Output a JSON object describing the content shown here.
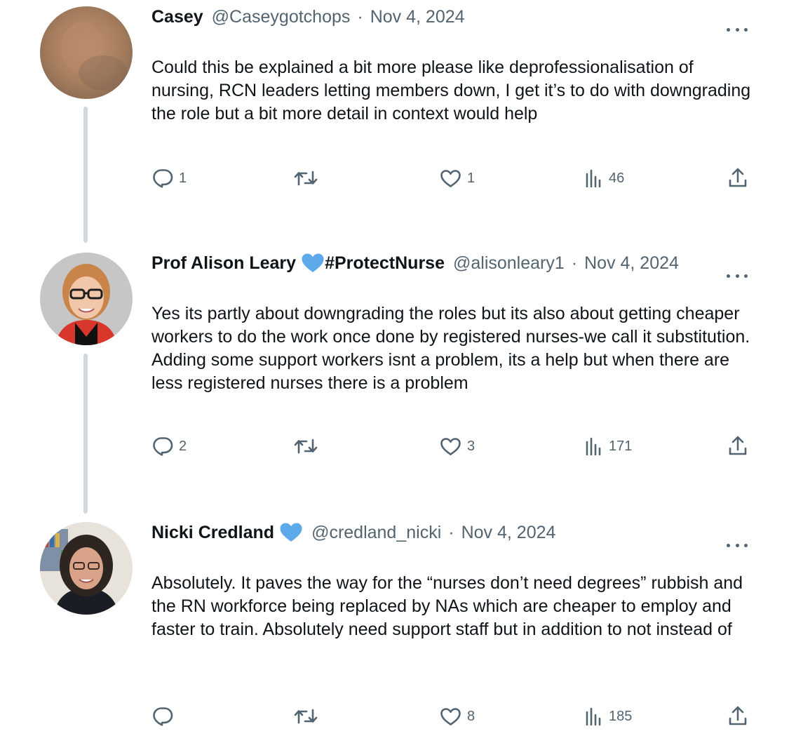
{
  "tweets": [
    {
      "name": "Casey",
      "verified_heart": false,
      "handle": "@Caseygotchops",
      "separator": "·",
      "date": "Nov 4, 2024",
      "text": "Could this be explained a bit more please like deprofessionalisation of nursing, RCN leaders letting members down, I get it’s to do with downgrading the role but a bit more detail in context would help",
      "replies": "1",
      "retweets": "",
      "likes": "1",
      "views": "46"
    },
    {
      "name": "Prof Alison Leary",
      "verified_heart": true,
      "name_suffix": "#ProtectNurse",
      "handle": "@alisonleary1",
      "separator": "·",
      "date": "Nov 4, 2024",
      "text": "Yes its partly about downgrading the roles but its also about getting cheaper workers to do the work once done by registered nurses-we call it substitution. Adding some support workers isnt a problem, its a help but when there are less registered nurses there is a problem",
      "replies": "2",
      "retweets": "",
      "likes": "3",
      "views": "171"
    },
    {
      "name": "Nicki Credland",
      "verified_heart": true,
      "handle": "@credland_nicki",
      "separator": "·",
      "date": "Nov 4, 2024",
      "text": "Absolutely. It paves the way for the “nurses don’t need degrees” rubbish and the RN workforce being replaced by NAs which are cheaper to employ and faster to train. Absolutely need support staff but in addition to not instead of",
      "replies": "",
      "retweets": "",
      "likes": "8",
      "views": "185"
    }
  ],
  "icons": {
    "reply": "reply-icon",
    "retweet": "retweet-icon",
    "like": "heart-icon",
    "views": "views-icon",
    "share": "share-icon",
    "more": "more-icon",
    "badge": "blue-heart-icon"
  },
  "colors": {
    "text": "#0f1419",
    "secondary": "#536471",
    "thread_line": "#cfd9de",
    "heart_badge": "#5ea9ea"
  }
}
